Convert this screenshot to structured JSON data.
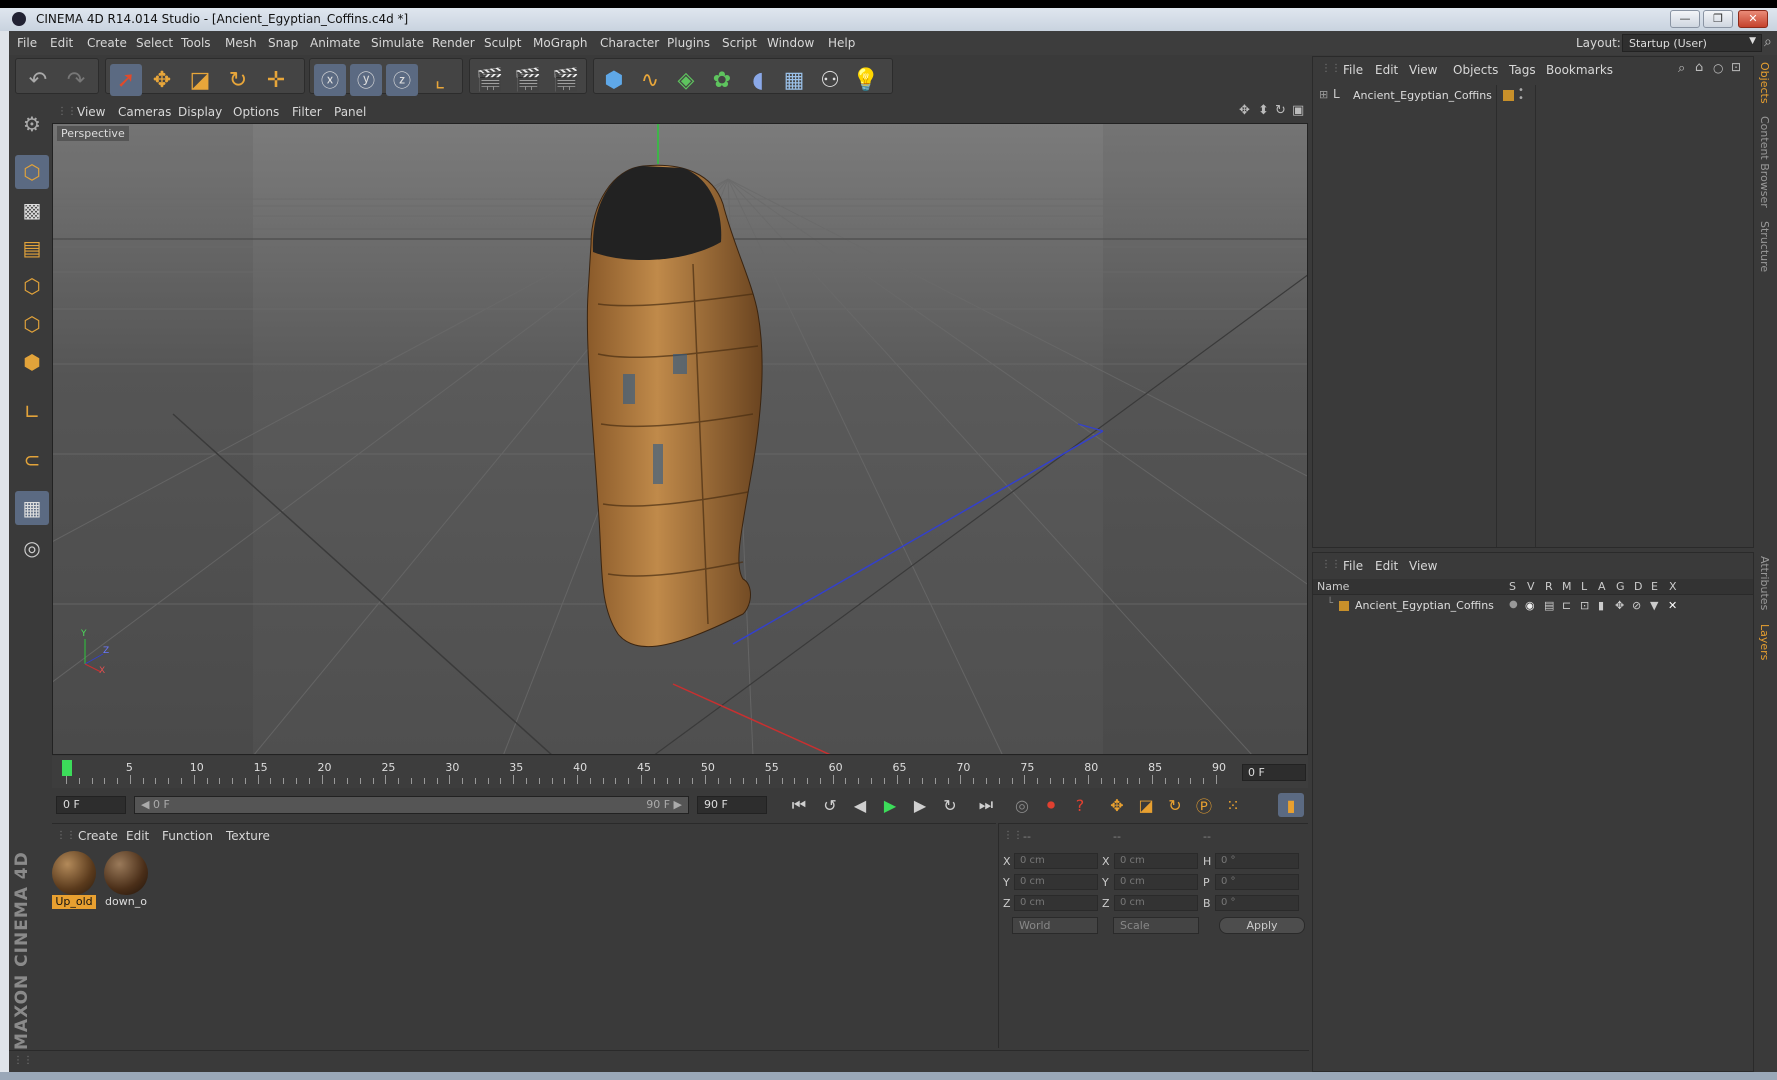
{
  "title": {
    "text": "CINEMA 4D R14.014 Studio - [Ancient_Egyptian_Coffins.c4d *]",
    "minimize": "—",
    "restore": "❐",
    "close": "✕"
  },
  "menu": [
    "File",
    "Edit",
    "Create",
    "Select",
    "Tools",
    "Mesh",
    "Snap",
    "Animate",
    "Simulate",
    "Render",
    "Sculpt",
    "MoGraph",
    "Character",
    "Plugins",
    "Script",
    "Window",
    "Help"
  ],
  "layout": {
    "label": "Layout:",
    "value": "Startup (User)"
  },
  "toolbar_icons": [
    "undo-icon",
    "redo-icon",
    "select-arrow-icon",
    "move-icon",
    "scale-icon",
    "rotate-icon",
    "add-icon",
    "x-axis-lock-icon",
    "y-axis-lock-icon",
    "z-axis-lock-icon",
    "world-coordinates-icon",
    "render-view-icon",
    "render-picture-viewer-icon",
    "edit-render-settings-icon",
    "cube-icon",
    "spline-icon",
    "nurbs-icon",
    "array-icon",
    "deformer-icon",
    "floor-icon",
    "camera-icon",
    "light-icon"
  ],
  "viewport": {
    "menu": [
      "View",
      "Cameras",
      "Display",
      "Options",
      "Filter",
      "Panel"
    ],
    "label": "Perspective",
    "axis_y": "Y",
    "axis_z": "Z",
    "axis_x": "X"
  },
  "timeline": {
    "ticks": [
      "0",
      "5",
      "10",
      "15",
      "20",
      "25",
      "30",
      "35",
      "40",
      "45",
      "50",
      "55",
      "60",
      "65",
      "70",
      "75",
      "80",
      "85",
      "90"
    ],
    "current_frame": "0 F",
    "start": "0 F",
    "range_start": "◀ 0 F",
    "range_end": "90 F ▶",
    "end": "90 F"
  },
  "materials": {
    "menu": [
      "Create",
      "Edit",
      "Function",
      "Texture"
    ],
    "items": [
      {
        "label": "Up_old"
      },
      {
        "label": "down_o"
      }
    ]
  },
  "coords": {
    "header": [
      "--",
      "--",
      "--"
    ],
    "rows": [
      {
        "l1": "X",
        "v1": "0 cm",
        "l2": "X",
        "v2": "0 cm",
        "l3": "H",
        "v3": "0 °"
      },
      {
        "l1": "Y",
        "v1": "0 cm",
        "l2": "Y",
        "v2": "0 cm",
        "l3": "P",
        "v3": "0 °"
      },
      {
        "l1": "Z",
        "v1": "0 cm",
        "l2": "Z",
        "v2": "0 cm",
        "l3": "B",
        "v3": "0 °"
      }
    ],
    "world": "World",
    "scale": "Scale",
    "apply": "Apply"
  },
  "objects": {
    "menu": [
      "File",
      "Edit",
      "View",
      "Objects",
      "Tags",
      "Bookmarks"
    ],
    "item": "Ancient_Egyptian_Coffins"
  },
  "layers": {
    "menu": [
      "File",
      "Edit",
      "View"
    ],
    "columns": [
      "Name",
      "S",
      "V",
      "R",
      "M",
      "L",
      "A",
      "G",
      "D",
      "E",
      "X"
    ],
    "item": "Ancient_Egyptian_Coffins"
  },
  "side_tabs": [
    "Objects",
    "Content Browser",
    "Structure",
    "Attributes",
    "Layers"
  ],
  "brand": "MAXON CINEMA 4D"
}
